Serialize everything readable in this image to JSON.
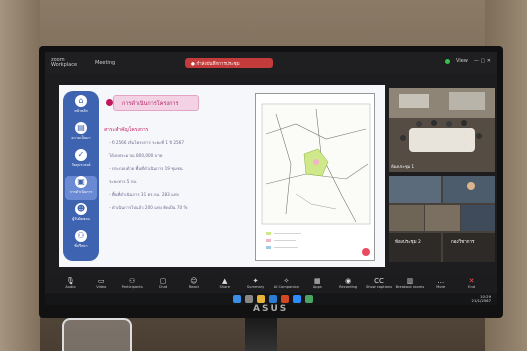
{
  "titlebar": {
    "app_name": "zoom Workplace",
    "meeting_label": "Meeting",
    "recording_pill": "● กำลังบันทึกการประชุม",
    "view_label": "View",
    "window_controls": "— ▢ ✕"
  },
  "slide": {
    "sidebar": [
      {
        "icon": "home-icon",
        "glyph": "⌂",
        "label": "หน้าหลัก"
      },
      {
        "icon": "id-card-icon",
        "glyph": "▤",
        "label": "ความเป็นมา"
      },
      {
        "icon": "check-icon",
        "glyph": "✓",
        "label": "วัตถุประสงค์"
      },
      {
        "icon": "briefcase-icon",
        "glyph": "▣",
        "label": "การดำเนินการ"
      },
      {
        "icon": "user-icon",
        "glyph": "☻",
        "label": "ผู้รับผิดชอบ"
      },
      {
        "icon": "group-icon",
        "glyph": "⚇",
        "label": "ที่ปรึกษา"
      }
    ],
    "heading": "การดำเนินการโครงการ",
    "subheading": "สาระสำคัญโครงการ",
    "bullets": [
      "- ปี 2566 เริ่มโครงการ ระยะที่ 1 ปี 2567",
      "  ได้งบประมาณ 800,000 บาท",
      "- ประกอบด้วย พื้นที่ดำเนินการ 19 ชุมชน",
      "  ระยะทาง 5 กม.",
      "- พื้นที่ดำเนินการ 31 ตร.กม. 283 แห่ง",
      "- ดำเนินการไปแล้ว 200 แห่ง คิดเป็น 70 %"
    ]
  },
  "participants": [
    {
      "name": "ห้องประชุม 1"
    },
    {
      "name": "ห้องประชุม 2"
    },
    {
      "name": "กองวิชาการ"
    }
  ],
  "toolbar": [
    {
      "icon": "microphone-icon",
      "glyph": "🎙",
      "label": "Audio"
    },
    {
      "icon": "video-icon",
      "glyph": "▭",
      "label": "Video"
    },
    {
      "icon": "participants-icon",
      "glyph": "⚇",
      "label": "Participants"
    },
    {
      "icon": "chat-icon",
      "glyph": "▢",
      "label": "Chat"
    },
    {
      "icon": "react-icon",
      "glyph": "☺",
      "label": "React"
    },
    {
      "icon": "share-icon",
      "glyph": "▲",
      "label": "Share"
    },
    {
      "icon": "summary-icon",
      "glyph": "✦",
      "label": "Summary"
    },
    {
      "icon": "ai-companion-icon",
      "glyph": "✧",
      "label": "AI Companion"
    },
    {
      "icon": "apps-icon",
      "glyph": "▦",
      "label": "Apps"
    },
    {
      "icon": "record-icon",
      "glyph": "◉",
      "label": "Recording"
    },
    {
      "icon": "captions-icon",
      "glyph": "CC",
      "label": "Show captions"
    },
    {
      "icon": "breakout-icon",
      "glyph": "▥",
      "label": "Breakout rooms"
    },
    {
      "icon": "more-icon",
      "glyph": "…",
      "label": "More"
    },
    {
      "icon": "end-icon",
      "glyph": "✕",
      "label": "End"
    }
  ],
  "taskbar": {
    "time": "10:29",
    "date": "21/1/2567"
  },
  "colors": {
    "sidebar": "#3e63b0",
    "heading_accent": "#c2185b",
    "recording": "#c43b3b"
  }
}
